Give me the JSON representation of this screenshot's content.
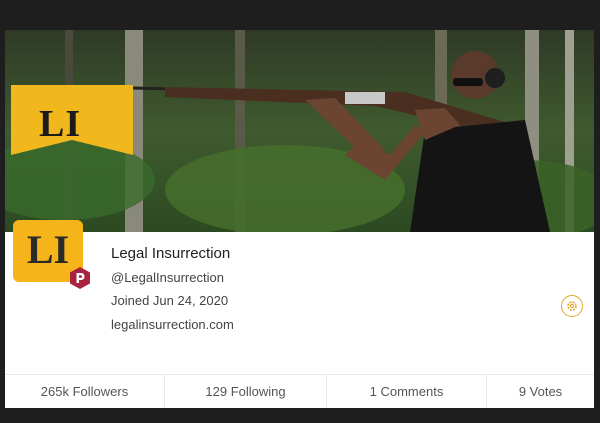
{
  "banner": {
    "flag_logo_text": "LI",
    "image_icon": "shooting-photo-banner"
  },
  "profile": {
    "avatar_text": "LI",
    "badge_icon": "parler-p-icon",
    "name": "Legal Insurrection",
    "handle": "@LegalInsurrection",
    "joined": "Joined Jun 24, 2020",
    "website": "legalinsurrection.com",
    "settings_icon": "gear-icon"
  },
  "stats": [
    {
      "label": "265k Followers"
    },
    {
      "label": "129 Following"
    },
    {
      "label": "1 Comments"
    },
    {
      "label": "9 Votes"
    }
  ],
  "colors": {
    "brand_gold": "#f4b41a",
    "parler_red": "#a8233f",
    "accent_border": "#e3a82f",
    "page_background": "#1e1e1e"
  }
}
